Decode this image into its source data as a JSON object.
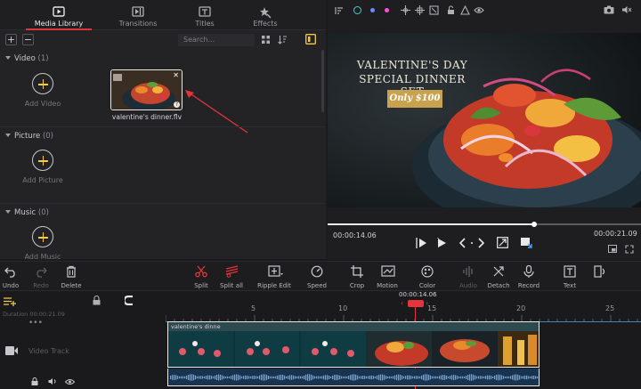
{
  "library": {
    "tabs": [
      {
        "label": "Media Library",
        "icon": "media-library-icon",
        "active": true
      },
      {
        "label": "Transitions",
        "icon": "transitions-icon",
        "active": false
      },
      {
        "label": "Titles",
        "icon": "titles-icon",
        "active": false
      },
      {
        "label": "Effects",
        "icon": "effects-icon",
        "active": false
      }
    ],
    "search_placeholder": "Search...",
    "sections": [
      {
        "name": "Video",
        "count": "(1)",
        "add_label": "Add Video"
      },
      {
        "name": "Picture",
        "count": "(0)",
        "add_label": "Add Picture"
      },
      {
        "name": "Music",
        "count": "(0)",
        "add_label": "Add Music"
      }
    ],
    "media_item": {
      "filename": "valentine's dinner.flv"
    }
  },
  "preview": {
    "overlay": {
      "title_line1": "VALENTINE'S DAY",
      "title_line2": "SPECIAL DINNER SET",
      "badge": "Only $100"
    },
    "current_time": "00:00:14.06",
    "total_time": "00:00:21.09",
    "progress": 0.659
  },
  "toolbar": {
    "items": [
      {
        "label": "Undo",
        "icon": "undo-icon",
        "enabled": true
      },
      {
        "label": "Redo",
        "icon": "redo-icon",
        "enabled": false
      },
      {
        "label": "Delete",
        "icon": "trash-icon",
        "enabled": true
      },
      {
        "label": "Split",
        "icon": "scissors-icon",
        "enabled": true
      },
      {
        "label": "Split all",
        "icon": "split-all-icon",
        "enabled": true
      },
      {
        "label": "Ripple Edit",
        "icon": "ripple-edit-icon",
        "enabled": true
      },
      {
        "label": "Speed",
        "icon": "speed-icon",
        "enabled": true
      },
      {
        "label": "Crop",
        "icon": "crop-icon",
        "enabled": true
      },
      {
        "label": "Motion",
        "icon": "motion-icon",
        "enabled": true
      },
      {
        "label": "Color",
        "icon": "color-icon",
        "enabled": true
      },
      {
        "label": "Audio",
        "icon": "audio-icon",
        "enabled": false
      },
      {
        "label": "Detach",
        "icon": "detach-icon",
        "enabled": true
      },
      {
        "label": "Record",
        "icon": "microphone-icon",
        "enabled": true
      },
      {
        "label": "Text",
        "icon": "text-icon",
        "enabled": true
      },
      {
        "label": "Volume",
        "icon": "volume-icon",
        "enabled": true
      }
    ]
  },
  "timeline": {
    "playhead_time": "00:00:14.06",
    "duration_label": "Duration",
    "duration_value": "00:00:21.09",
    "ruler_labels": [
      "5",
      "10",
      "15",
      "20",
      "25"
    ],
    "track_label": "Video Track",
    "clip_name": "valentine's dinne",
    "more": "•••"
  },
  "colors": {
    "accent_red": "#d9363e",
    "badge_gold": "#c8a24f",
    "add_plus": "#f2c94c",
    "clip_border": "#e8e8ea"
  }
}
